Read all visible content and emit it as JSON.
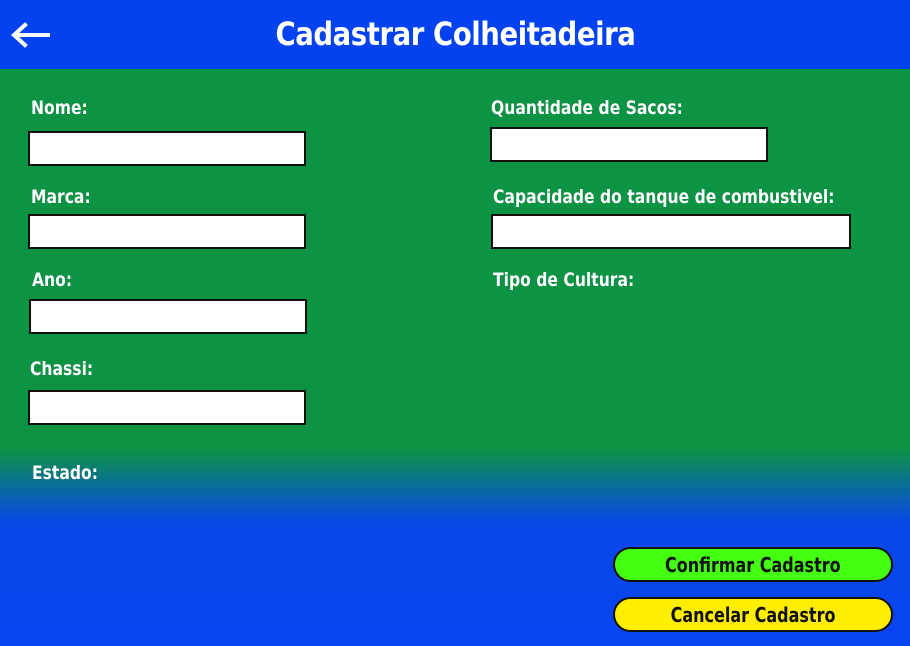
{
  "header": {
    "title": "Cadastrar Colheitadeira",
    "back_icon": "arrow-left-icon"
  },
  "form": {
    "nome": {
      "label": "Nome:",
      "value": ""
    },
    "marca": {
      "label": "Marca:",
      "value": ""
    },
    "ano": {
      "label": "Ano:",
      "value": ""
    },
    "chassi": {
      "label": "Chassi:",
      "value": ""
    },
    "estado": {
      "label": "Estado:"
    },
    "quantidade_sacos": {
      "label": "Quantidade de Sacos:",
      "value": ""
    },
    "capacidade_tanque": {
      "label": "Capacidade do tanque de combustivel:",
      "value": ""
    },
    "tipo_cultura": {
      "label": "Tipo de Cultura:"
    }
  },
  "actions": {
    "confirm_label": "Confirmar Cadastro",
    "cancel_label": "Cancelar Cadastro"
  },
  "colors": {
    "header_blue": "#0442f0",
    "form_green": "#0c9444",
    "bottom_blue": "#0844f0",
    "confirm_green": "#45ff12",
    "cancel_yellow": "#ffee00"
  }
}
